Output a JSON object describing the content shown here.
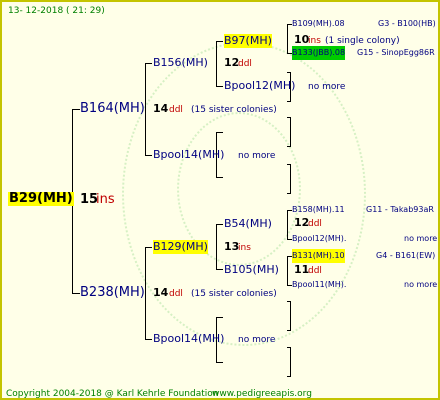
{
  "date": "13- 12-2018 ( 21: 29)",
  "footer": {
    "copyright": "Copyright 2004-2018 @ Karl Kehrle Foundation",
    "site": "www.pedigreeapis.org"
  },
  "root": {
    "name": "B29(MH)",
    "num": "15",
    "tag": "ins"
  },
  "gen1": {
    "upper": {
      "name": "B164(MH)",
      "num": "14",
      "tag": "ddl",
      "note": "(15 sister colonies)"
    },
    "lower": {
      "name": "B238(MH)",
      "num": "14",
      "tag": "ddl",
      "note": "(15 sister colonies)"
    }
  },
  "gen2": {
    "a": {
      "name": "B156(MH)",
      "num": "12",
      "tag": "ddl"
    },
    "b": {
      "name": "Bpool14(MH)",
      "extra": "no more"
    },
    "c": {
      "name": "B129(MH)",
      "num": "13",
      "tag": "ins"
    },
    "d": {
      "name": "Bpool14(MH)",
      "extra": "no more"
    }
  },
  "gen3": {
    "a": {
      "name": "B97(MH)",
      "num": "10",
      "tag": "ins",
      "note": "(1 single colony)"
    },
    "b": {
      "name": "Bpool12(MH)",
      "extra": "no more"
    },
    "c": {
      "name": "B54(MH)",
      "num": "12",
      "tag": "ddl"
    },
    "d": {
      "name": "B105(MH)",
      "num": "11",
      "tag": "ddl"
    }
  },
  "gen4": {
    "a1": {
      "name": "B109(MH).08",
      "info": "G3 - B100(HB)"
    },
    "a2": {
      "name": "B133(JBB).08",
      "info": "G15 - SinopEgg86R"
    },
    "c1": {
      "name": "B158(MH).11",
      "info": "G11 - Takab93aR"
    },
    "c2": {
      "name": "Bpool12(MH).",
      "info": "no more"
    },
    "d1": {
      "name": "B131(MH).10",
      "info": "G4 - B161(EW)"
    },
    "d2": {
      "name": "Bpool11(MH).",
      "info": "no more"
    }
  },
  "colors": {
    "border": "#c4c400",
    "background": "#ffffe8",
    "text": "#000080",
    "highlight": "#ffff00",
    "highlight_green": "#00cc00",
    "accent_red": "#c00000",
    "footer": "#008000"
  }
}
